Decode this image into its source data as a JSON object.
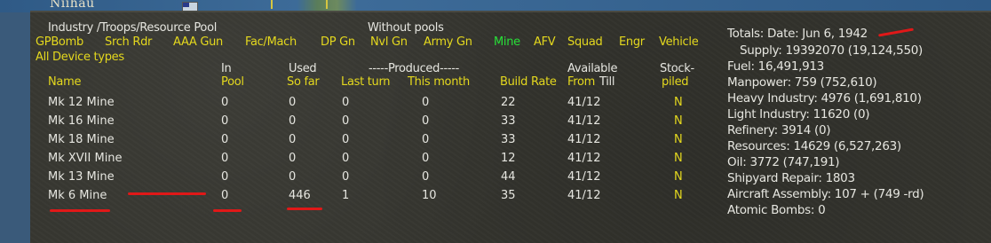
{
  "map": {
    "location": "Niihau"
  },
  "header": {
    "pool_title": "Industry /Troops/Resource Pool",
    "without_pools": "Without pools"
  },
  "filters": [
    {
      "label": "GPBomb",
      "color": "#e4d81e"
    },
    {
      "label": "Srch Rdr",
      "color": "#e4d81e"
    },
    {
      "label": "AAA Gun",
      "color": "#e4d81e"
    },
    {
      "label": "Fac/Mach",
      "color": "#e4d81e"
    },
    {
      "label": "DP Gn",
      "color": "#e4d81e"
    },
    {
      "label": "Nvl Gn",
      "color": "#e4d81e"
    },
    {
      "label": "Army Gn",
      "color": "#e4d81e"
    },
    {
      "label": "Mine",
      "color": "#28e038",
      "selected": true
    },
    {
      "label": "AFV",
      "color": "#e4d81e"
    },
    {
      "label": "Squad",
      "color": "#e4d81e"
    },
    {
      "label": "Engr",
      "color": "#e4d81e"
    },
    {
      "label": "Vehicle",
      "color": "#e4d81e"
    }
  ],
  "all_device_types": "All Device types",
  "columns": {
    "name": "Name",
    "in_pool_top": "In",
    "in_pool_bottom": "Pool",
    "used_top": "Used",
    "used_bottom": "So far",
    "produced_top": "-----Produced-----",
    "last_turn": "Last turn",
    "this_month": "This month",
    "build_rate": "Build Rate",
    "available_top": "Available",
    "available_from": "From",
    "available_till": "Till",
    "stock_top": "Stock-",
    "stock_bottom": "piled"
  },
  "rows": [
    {
      "name": "Mk 12 Mine",
      "in_pool": "0",
      "used": "0",
      "last_turn": "0",
      "this_month": "0",
      "build_rate": "22",
      "from": "41/12",
      "stock": "N"
    },
    {
      "name": "Mk 16 Mine",
      "in_pool": "0",
      "used": "0",
      "last_turn": "0",
      "this_month": "0",
      "build_rate": "33",
      "from": "41/12",
      "stock": "N"
    },
    {
      "name": "Mk 18 Mine",
      "in_pool": "0",
      "used": "0",
      "last_turn": "0",
      "this_month": "0",
      "build_rate": "33",
      "from": "41/12",
      "stock": "N"
    },
    {
      "name": "Mk XVII Mine",
      "in_pool": "0",
      "used": "0",
      "last_turn": "0",
      "this_month": "0",
      "build_rate": "12",
      "from": "41/12",
      "stock": "N"
    },
    {
      "name": "Mk 13 Mine",
      "in_pool": "0",
      "used": "0",
      "last_turn": "0",
      "this_month": "0",
      "build_rate": "44",
      "from": "41/12",
      "stock": "N"
    },
    {
      "name": "Mk 6 Mine",
      "in_pool": "0",
      "used": "446",
      "last_turn": "1",
      "this_month": "10",
      "build_rate": "35",
      "from": "41/12",
      "stock": "N"
    }
  ],
  "totals": {
    "date_line": "Totals:  Date: Jun 6, 1942",
    "supply": "Supply: 19392070 (19,124,550)",
    "fuel": "Fuel: 16,491,913",
    "manpower": "Manpower: 759 (752,610)",
    "heavy_industry": "Heavy Industry: 4976 (1,691,810)",
    "light_industry": "Light Industry: 11620 (0)",
    "refinery": "Refinery: 3914 (0)",
    "resources": "Resources: 14629 (6,527,263)",
    "oil": "Oil: 3772 (747,191)",
    "shipyard": "Shipyard Repair: 1803",
    "aircraft": "Aircraft Assembly: 107 + (749 -rd)",
    "atomic": "Atomic Bombs: 0"
  },
  "colors": {
    "yellow": "#e4d81e",
    "green": "#28e038",
    "white": "#e6e6e0",
    "red_mark": "#e01818",
    "panel": "#35352f"
  }
}
